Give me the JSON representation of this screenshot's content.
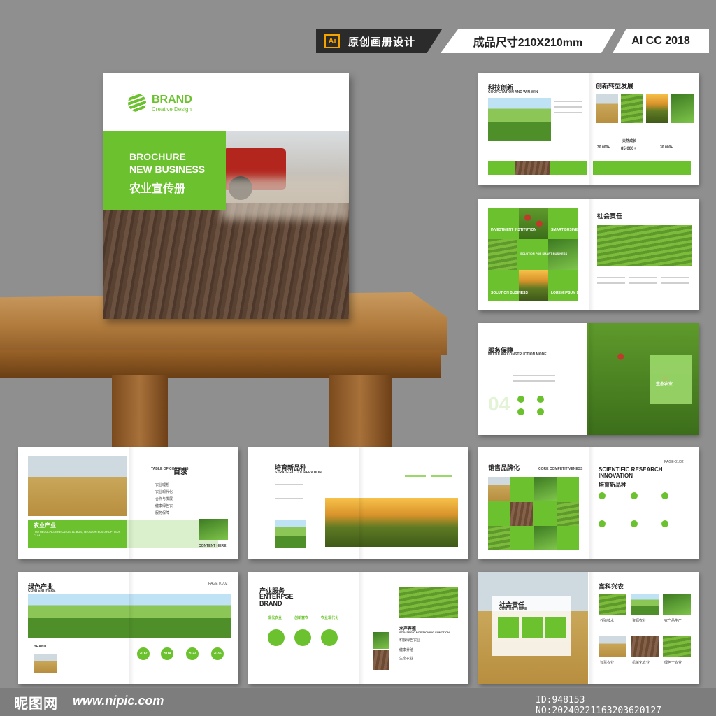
{
  "banner": {
    "ai_badge": "Ai",
    "original_design": "原创画册设计",
    "size": "成品尺寸210X210mm",
    "version": "AI CC 2018"
  },
  "cover": {
    "brand": "BRAND",
    "brand_sub": "Creative Design",
    "title_en_1": "BROCHURE",
    "title_en_2": "NEW BUSINESS",
    "title_cn": "农业宣传册"
  },
  "spreads": {
    "s1": {
      "title": "科技创新",
      "sub": "COOPERATION AND WIN-WIN",
      "right_title": "创新转型发展",
      "stat1": "30.000+",
      "stat2": "85.000+",
      "stat3": "30.000+",
      "note": "天然成长"
    },
    "s2": {
      "title": "社会责任",
      "left1": "INVESTMENT INSTITUTION",
      "left2": "SMART BUSINESS",
      "left3": "SOLUTION FOR SMART BUSINESS",
      "left4": "SOLUTION BUSINESS",
      "left5": "LOREM IPSUM DOLOR"
    },
    "s3": {
      "title": "服务保障",
      "sub": "MODULAR CONSTRUCTION MODE",
      "num": "04",
      "right_title": "生态农业"
    },
    "s4": {
      "toc_en": "TABLE OF CONTENTS",
      "toc_cn": "目录",
      "items": [
        "农业理想",
        "农业现代化",
        "合作与发展",
        "健康绿色农",
        "服务保障"
      ],
      "banner_cn": "农业产业",
      "banner_en": "ITIO NECULPA DERECATUS, ALIBUS, TE ODION EUM ARUPTIBUS CUM",
      "content_here": "CONTENT HERE"
    },
    "s5": {
      "title": "培育新品种",
      "sub": "STRATEGIC COOPERATION"
    },
    "s6": {
      "title": "销售品牌化",
      "sub": "CORE COMPETITIVENESS",
      "right_en": "SCIENTIFIC RESEARCH INNOVATION",
      "right_cn": "培育新品种",
      "page": "PAGE-01/02"
    },
    "s7": {
      "title": "绿色产业",
      "sub": "CONTENT HERE",
      "page": "PAGE 01/02",
      "years": [
        "2012",
        "2014",
        "2022",
        "2035"
      ],
      "brand": "BRAND"
    },
    "s8": {
      "title_cn": "产业服务",
      "title_en1": "ENTERPSE",
      "title_en2": "BRAND",
      "items": [
        "现代农业",
        "创新富农",
        "农业现代化"
      ],
      "right_title": "水产养殖",
      "right_sub": "STRATEGIC POSITIONING FUNCTION",
      "labels": [
        "积极绿色农业",
        "健康养殖",
        "生态农业"
      ]
    },
    "s9": {
      "title": "社会责任",
      "sub": "CONTENT HERE",
      "right_title": "高科兴农",
      "boxes": [
        "养殖技术",
        "资源农业",
        "农产品生产",
        "智慧农业",
        "机械化农业",
        "绿色一农业"
      ]
    }
  },
  "footer": {
    "site_cn": "昵图网",
    "site_url": "www.nipic.com",
    "image_id": "ID:948153 NO:20240221163203620127"
  }
}
